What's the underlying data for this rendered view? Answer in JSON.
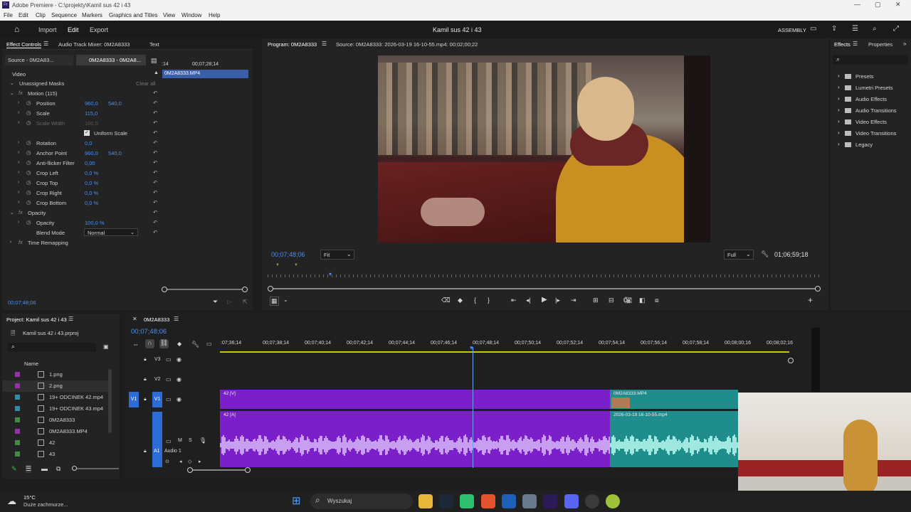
{
  "window": {
    "title": "Adobe Premiere - C:\\projekty\\Kamil sus 42 i 43"
  },
  "menu": [
    "File",
    "Edit",
    "Clip",
    "Sequence",
    "Markers",
    "Graphics and Titles",
    "View",
    "Window",
    "Help"
  ],
  "header": {
    "import": "Import",
    "edit": "Edit",
    "export": "Export",
    "project_title": "Kamil sus 42 i 43",
    "workspace": "ASSEMBLY"
  },
  "effect_controls": {
    "tabs": [
      "Effect Controls",
      "Audio Track Mixer: 0M2A8333",
      "Text"
    ],
    "source_tab": "Source - 0M2A83...",
    "clip_tab": "0M2A8333 - 0M2A8...",
    "mini_tc1": ":14",
    "mini_tc2": "00;07;28;14",
    "clip_label": "0M2A8333.MP4",
    "video": "Video",
    "masks": "Unassigned Masks",
    "clear_all": "Clear all",
    "motion": "Motion (115)",
    "props": [
      {
        "label": "Position",
        "v1": "960,0",
        "v2": "540,0"
      },
      {
        "label": "Scale",
        "v1": "115,0",
        "v2": ""
      },
      {
        "label": "Scale Width",
        "v1": "100,0",
        "v2": ""
      },
      {
        "label": "Uniform Scale",
        "v1": "",
        "v2": ""
      },
      {
        "label": "Rotation",
        "v1": "0,0",
        "v2": ""
      },
      {
        "label": "Anchor Point",
        "v1": "960,0",
        "v2": "540,0"
      },
      {
        "label": "Anti-flicker Filter",
        "v1": "0,00",
        "v2": ""
      },
      {
        "label": "Crop Left",
        "v1": "0,0 %",
        "v2": ""
      },
      {
        "label": "Crop Top",
        "v1": "0,0 %",
        "v2": ""
      },
      {
        "label": "Crop Right",
        "v1": "0,0 %",
        "v2": ""
      },
      {
        "label": "Crop Bottom",
        "v1": "0,0 %",
        "v2": ""
      }
    ],
    "opacity_group": "Opacity",
    "opacity_label": "Opacity",
    "opacity_value": "100,0 %",
    "blend_label": "Blend Mode",
    "blend_value": "Normal",
    "time_remap": "Time Remapping",
    "timecode": "00;07;48;06"
  },
  "program": {
    "tab": "Program: 0M2A8333",
    "source": "Source: 0M2A8333: 2026-03-19 16-10-55.mp4: 00;02;00;22",
    "timecode": "00;07;48;06",
    "fit": "Fit",
    "quality": "Full",
    "duration": "01;06;59;18"
  },
  "effects": {
    "tab": "Effects",
    "props_tab": "Properties",
    "items": [
      "Presets",
      "Lumetri Presets",
      "Audio Effects",
      "Audio Transitions",
      "Video Effects",
      "Video Transitions",
      "Legacy"
    ]
  },
  "project": {
    "title": "Project: Kamil sus 42 i 43",
    "file": "Kamil sus 42 i 43.prproj",
    "name_col": "Name",
    "items": [
      {
        "name": "1.png",
        "color": "#9c2cb0"
      },
      {
        "name": "2.png",
        "color": "#9c2cb0"
      },
      {
        "name": "19+  ODCINEK 42.mp4",
        "color": "#2a8fa8"
      },
      {
        "name": "19+  ODCINEK 43.mp4",
        "color": "#2a8fa8"
      },
      {
        "name": "0M2A8333",
        "color": "#3f8f3a"
      },
      {
        "name": "0M2A8333.MP4",
        "color": "#9c2cb0"
      },
      {
        "name": "42",
        "color": "#3f8f3a"
      },
      {
        "name": "43",
        "color": "#3f8f3a"
      }
    ]
  },
  "timeline": {
    "tab": "0M2A8333",
    "timecode": "00;07;48;06",
    "ruler": [
      ":07;36;14",
      "00;07;38;14",
      "00;07;40;14",
      "00;07;42;14",
      "00;07;44;14",
      "00;07;46;14",
      "00;07;48;14",
      "00;07;50;14",
      "00;07;52;14",
      "00;07;54;14",
      "00;07;56;14",
      "00;07;58;14",
      "00;08;00;16",
      "00;08;02;16"
    ],
    "tracks": {
      "v3": "V3",
      "v2": "V2",
      "v1": "V1",
      "a1": "A1",
      "audio1": "Audio 1"
    },
    "clip_v": "42 [V]",
    "clip_a": "42 [A]",
    "clip_v2": "0M2A8333.MP4",
    "clip_a2": "2026-03-19 16-10-55.mp4"
  },
  "taskbar": {
    "temp": "15°C",
    "weather": "Duże zachmurze...",
    "search": "Wyszukaj"
  },
  "colors": {
    "accent": "#4e8ef2",
    "clip_purple": "#7a1fc9",
    "clip_teal": "#1e8d8c",
    "audio_wave": "#c79ef0"
  }
}
